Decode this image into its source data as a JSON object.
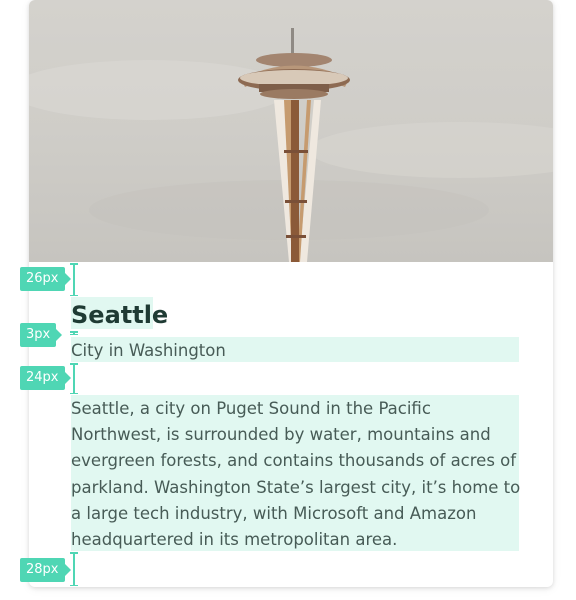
{
  "card": {
    "title": "Seattle",
    "subtitle": "City in Washington",
    "description": "Seattle, a city on Puget Sound in the Pacific Northwest, is surrounded by water, mountains and evergreen forests, and contains thousands of acres of parkland. Washington State’s largest city, it’s home to a large tech industry, with Microsoft and Amazon headquartered in its metropolitan area."
  },
  "spacing_labels": {
    "image_to_title": "26px",
    "title_to_subtitle": "3px",
    "subtitle_to_body": "24px",
    "body_to_bottom": "28px"
  },
  "colors": {
    "accent": "#4fd6b4",
    "highlight": "#dcf7ef",
    "title": "#1f3b34",
    "text": "#475b56"
  }
}
